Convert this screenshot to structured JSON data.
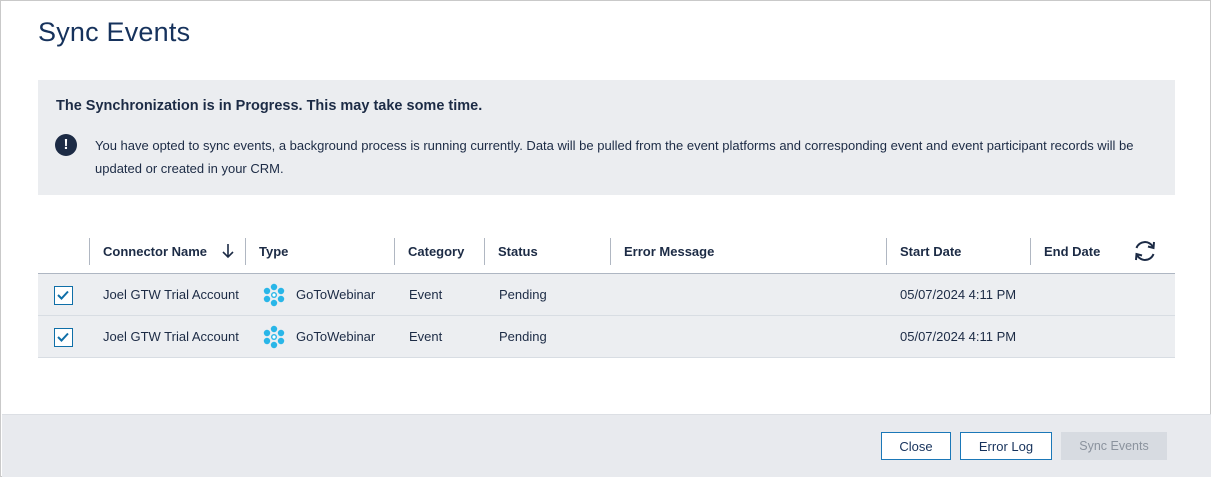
{
  "dialog": {
    "title": "Sync Events"
  },
  "banner": {
    "heading": "The Synchronization is in Progress. This may take some time.",
    "icon": "exclamation-circle-icon",
    "message": "You have opted to sync events, a background process is running currently. Data will be pulled from the event platforms and corresponding event and event participant records will be updated or created in your CRM."
  },
  "table": {
    "columns": {
      "connector_name": "Connector Name",
      "type": "Type",
      "category": "Category",
      "status": "Status",
      "error_message": "Error Message",
      "start_date": "Start Date",
      "end_date": "End Date"
    },
    "sort_icon": "arrow-down-icon",
    "refresh_icon": "refresh-icon",
    "rows": [
      {
        "checked": true,
        "connector_name": "Joel GTW Trial Account",
        "type": "GoToWebinar",
        "category": "Event",
        "status": "Pending",
        "error_message": "",
        "start_date": "05/07/2024 4:11 PM",
        "end_date": ""
      },
      {
        "checked": true,
        "connector_name": "Joel GTW Trial Account",
        "type": "GoToWebinar",
        "category": "Event",
        "status": "Pending",
        "error_message": "",
        "start_date": "05/07/2024 4:11 PM",
        "end_date": ""
      }
    ]
  },
  "footer": {
    "close_label": "Close",
    "error_log_label": "Error Log",
    "sync_events_label": "Sync Events"
  },
  "colors": {
    "title": "#16325c",
    "banner_bg": "#ebedf0",
    "row_bg": "#eceef1",
    "accent": "#1b78b8",
    "gtw_icon": "#29b6e8",
    "disabled_button": "#d7dbe1"
  }
}
